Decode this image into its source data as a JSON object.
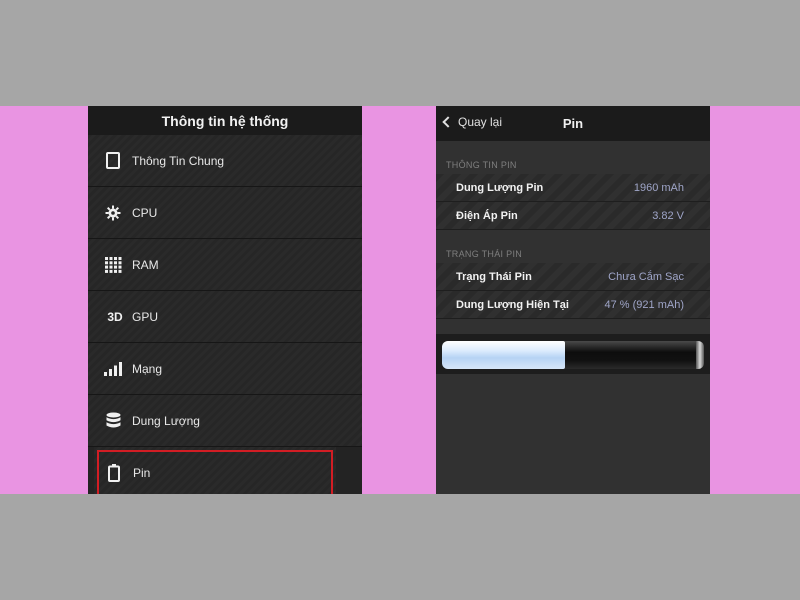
{
  "left": {
    "title": "Thông tin hệ thống",
    "menu": [
      {
        "id": "general",
        "label": "Thông Tin Chung",
        "icon": "tablet-icon"
      },
      {
        "id": "cpu",
        "label": "CPU",
        "icon": "gear-icon"
      },
      {
        "id": "ram",
        "label": "RAM",
        "icon": "grid-icon"
      },
      {
        "id": "gpu",
        "label": "GPU",
        "icon": "3d-icon",
        "icon_text": "3D"
      },
      {
        "id": "network",
        "label": "Mạng",
        "icon": "signal-icon"
      },
      {
        "id": "storage",
        "label": "Dung Lượng",
        "icon": "database-icon"
      },
      {
        "id": "battery",
        "label": "Pin",
        "icon": "battery-icon",
        "selected": true
      }
    ]
  },
  "right": {
    "back_label": "Quay lại",
    "title": "Pin",
    "section_info": "THÔNG TIN PIN",
    "info_rows": [
      {
        "label": "Dung Lượng Pin",
        "value": "1960 mAh"
      },
      {
        "label": "Điện Áp Pin",
        "value": "3.82 V"
      }
    ],
    "section_status": "TRẠNG THÁI PIN",
    "status_rows": [
      {
        "label": "Trạng Thái Pin",
        "value": "Chưa Cắm Sạc"
      },
      {
        "label": "Dung Lượng Hiện Tại",
        "value": "47 % (921 mAh)"
      }
    ],
    "battery_level": 0.47
  },
  "colors": {
    "background": "#a6a6a6",
    "band": "#e994e2",
    "selection_outline": "#d21d24",
    "value_text": "#9fa5c8"
  }
}
